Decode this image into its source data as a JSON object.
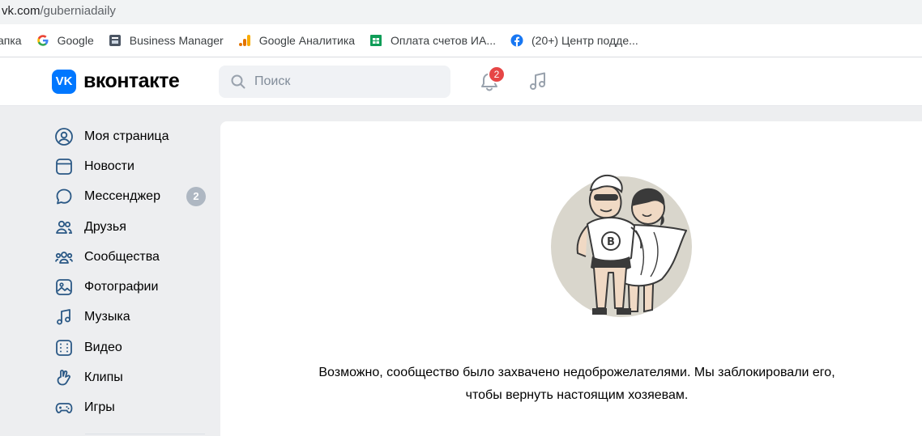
{
  "browser": {
    "url_domain": "vk.com",
    "url_path": "/guberniadaily"
  },
  "bookmarks": [
    {
      "label": "апка",
      "icon": "folder-icon"
    },
    {
      "label": "Google",
      "icon": "google-icon"
    },
    {
      "label": "Business Manager",
      "icon": "business-manager-icon"
    },
    {
      "label": "Google Аналитика",
      "icon": "analytics-icon"
    },
    {
      "label": "Оплата счетов ИА...",
      "icon": "sheets-icon"
    },
    {
      "label": "(20+) Центр подде...",
      "icon": "facebook-icon"
    }
  ],
  "header": {
    "logo_mark": "VK",
    "logo_text": "вконтакте",
    "search_placeholder": "Поиск",
    "notifications_count": "2"
  },
  "sidebar": {
    "items": [
      {
        "label": "Моя страница",
        "icon": "user-circle-icon"
      },
      {
        "label": "Новости",
        "icon": "news-icon"
      },
      {
        "label": "Мессенджер",
        "icon": "message-icon",
        "count": "2"
      },
      {
        "label": "Друзья",
        "icon": "friends-icon"
      },
      {
        "label": "Сообщества",
        "icon": "communities-icon"
      },
      {
        "label": "Фотографии",
        "icon": "photo-icon"
      },
      {
        "label": "Музыка",
        "icon": "music-icon"
      },
      {
        "label": "Видео",
        "icon": "video-icon"
      },
      {
        "label": "Клипы",
        "icon": "clips-icon"
      },
      {
        "label": "Игры",
        "icon": "games-icon"
      }
    ]
  },
  "main": {
    "message_line1": "Возможно, сообщество было захвачено недоброжелателями. Мы заблокировали его,",
    "message_line2": "чтобы вернуть настоящим хозяевам."
  },
  "colors": {
    "vk_blue": "#0077ff",
    "icon_blue": "#2a5885",
    "badge_red": "#e64646",
    "page_bg": "#edeef0"
  }
}
